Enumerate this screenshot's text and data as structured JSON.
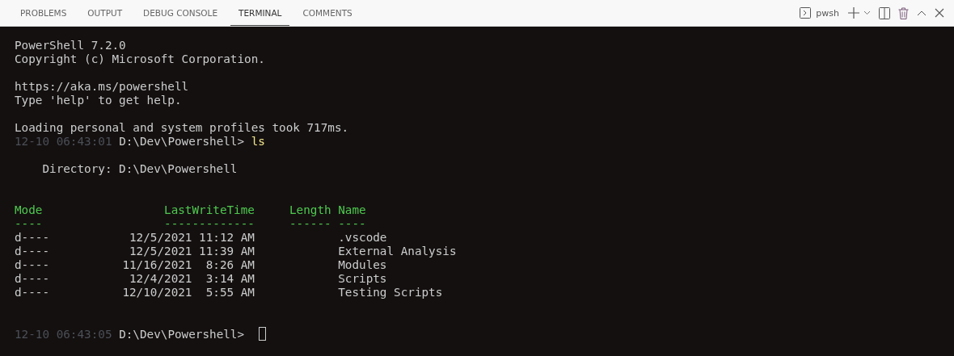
{
  "panel_tabs": [
    {
      "label": "PROBLEMS",
      "selected": false
    },
    {
      "label": "OUTPUT",
      "selected": false
    },
    {
      "label": "DEBUG CONSOLE",
      "selected": false
    },
    {
      "label": "TERMINAL",
      "selected": true
    },
    {
      "label": "COMMENTS",
      "selected": false
    }
  ],
  "terminal_selector": {
    "label": "pwsh"
  },
  "terminal": {
    "lines_before": [
      {
        "kind": "text",
        "text": "PowerShell 7.2.0"
      },
      {
        "kind": "text",
        "text": "Copyright (c) Microsoft Corporation."
      },
      {
        "kind": "blank"
      },
      {
        "kind": "text",
        "text": "https://aka.ms/powershell"
      },
      {
        "kind": "text",
        "text": "Type 'help' to get help."
      },
      {
        "kind": "blank"
      },
      {
        "kind": "text",
        "text": "Loading personal and system profiles took 717ms."
      },
      {
        "kind": "prompt",
        "timestamp": "12-10 06:43:01",
        "path": "D:\\Dev\\Powershell>",
        "command": "ls"
      },
      {
        "kind": "blank"
      },
      {
        "kind": "directory",
        "text": "Directory: D:\\Dev\\Powershell"
      },
      {
        "kind": "blank"
      }
    ],
    "table": {
      "columns": [
        "Mode",
        "LastWriteTime",
        "Length",
        "Name"
      ],
      "underlines": [
        "----",
        "-------------",
        "------",
        "----"
      ],
      "rows": [
        {
          "mode": "d----",
          "last_write_time": "12/5/2021 11:12 AM",
          "name": ".vscode"
        },
        {
          "mode": "d----",
          "last_write_time": "12/5/2021 11:39 AM",
          "name": "External Analysis"
        },
        {
          "mode": "d----",
          "last_write_time": "11/16/2021  8:26 AM",
          "name": "Modules"
        },
        {
          "mode": "d----",
          "last_write_time": "12/4/2021  3:14 AM",
          "name": "Scripts"
        },
        {
          "mode": "d----",
          "last_write_time": "12/10/2021  5:55 AM",
          "name": "Testing Scripts"
        }
      ]
    },
    "lines_after": [
      {
        "kind": "blank"
      },
      {
        "kind": "prompt",
        "timestamp": "12-10 06:43:05",
        "path": "D:\\Dev\\Powershell>",
        "cursor": true
      }
    ]
  }
}
